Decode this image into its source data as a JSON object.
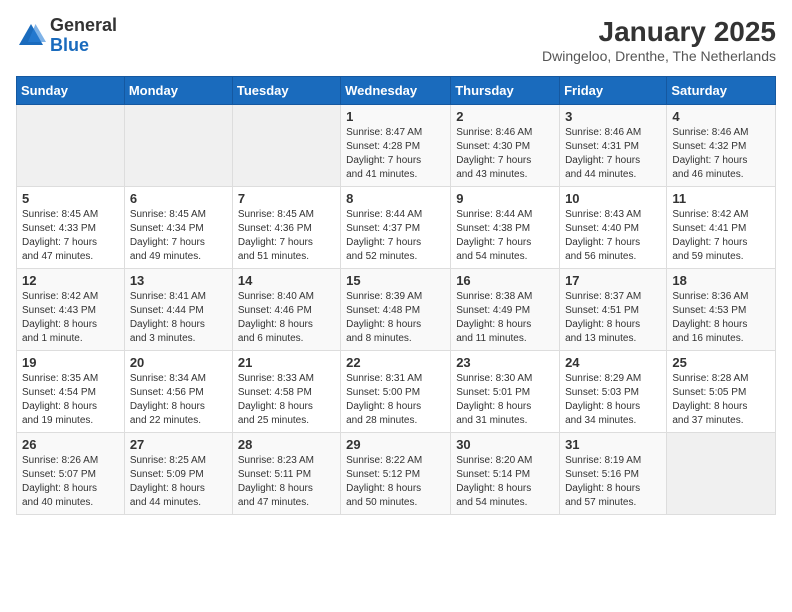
{
  "header": {
    "logo_general": "General",
    "logo_blue": "Blue",
    "title": "January 2025",
    "subtitle": "Dwingeloo, Drenthe, The Netherlands"
  },
  "weekdays": [
    "Sunday",
    "Monday",
    "Tuesday",
    "Wednesday",
    "Thursday",
    "Friday",
    "Saturday"
  ],
  "weeks": [
    [
      {
        "day": "",
        "info": ""
      },
      {
        "day": "",
        "info": ""
      },
      {
        "day": "",
        "info": ""
      },
      {
        "day": "1",
        "info": "Sunrise: 8:47 AM\nSunset: 4:28 PM\nDaylight: 7 hours\nand 41 minutes."
      },
      {
        "day": "2",
        "info": "Sunrise: 8:46 AM\nSunset: 4:30 PM\nDaylight: 7 hours\nand 43 minutes."
      },
      {
        "day": "3",
        "info": "Sunrise: 8:46 AM\nSunset: 4:31 PM\nDaylight: 7 hours\nand 44 minutes."
      },
      {
        "day": "4",
        "info": "Sunrise: 8:46 AM\nSunset: 4:32 PM\nDaylight: 7 hours\nand 46 minutes."
      }
    ],
    [
      {
        "day": "5",
        "info": "Sunrise: 8:45 AM\nSunset: 4:33 PM\nDaylight: 7 hours\nand 47 minutes."
      },
      {
        "day": "6",
        "info": "Sunrise: 8:45 AM\nSunset: 4:34 PM\nDaylight: 7 hours\nand 49 minutes."
      },
      {
        "day": "7",
        "info": "Sunrise: 8:45 AM\nSunset: 4:36 PM\nDaylight: 7 hours\nand 51 minutes."
      },
      {
        "day": "8",
        "info": "Sunrise: 8:44 AM\nSunset: 4:37 PM\nDaylight: 7 hours\nand 52 minutes."
      },
      {
        "day": "9",
        "info": "Sunrise: 8:44 AM\nSunset: 4:38 PM\nDaylight: 7 hours\nand 54 minutes."
      },
      {
        "day": "10",
        "info": "Sunrise: 8:43 AM\nSunset: 4:40 PM\nDaylight: 7 hours\nand 56 minutes."
      },
      {
        "day": "11",
        "info": "Sunrise: 8:42 AM\nSunset: 4:41 PM\nDaylight: 7 hours\nand 59 minutes."
      }
    ],
    [
      {
        "day": "12",
        "info": "Sunrise: 8:42 AM\nSunset: 4:43 PM\nDaylight: 8 hours\nand 1 minute."
      },
      {
        "day": "13",
        "info": "Sunrise: 8:41 AM\nSunset: 4:44 PM\nDaylight: 8 hours\nand 3 minutes."
      },
      {
        "day": "14",
        "info": "Sunrise: 8:40 AM\nSunset: 4:46 PM\nDaylight: 8 hours\nand 6 minutes."
      },
      {
        "day": "15",
        "info": "Sunrise: 8:39 AM\nSunset: 4:48 PM\nDaylight: 8 hours\nand 8 minutes."
      },
      {
        "day": "16",
        "info": "Sunrise: 8:38 AM\nSunset: 4:49 PM\nDaylight: 8 hours\nand 11 minutes."
      },
      {
        "day": "17",
        "info": "Sunrise: 8:37 AM\nSunset: 4:51 PM\nDaylight: 8 hours\nand 13 minutes."
      },
      {
        "day": "18",
        "info": "Sunrise: 8:36 AM\nSunset: 4:53 PM\nDaylight: 8 hours\nand 16 minutes."
      }
    ],
    [
      {
        "day": "19",
        "info": "Sunrise: 8:35 AM\nSunset: 4:54 PM\nDaylight: 8 hours\nand 19 minutes."
      },
      {
        "day": "20",
        "info": "Sunrise: 8:34 AM\nSunset: 4:56 PM\nDaylight: 8 hours\nand 22 minutes."
      },
      {
        "day": "21",
        "info": "Sunrise: 8:33 AM\nSunset: 4:58 PM\nDaylight: 8 hours\nand 25 minutes."
      },
      {
        "day": "22",
        "info": "Sunrise: 8:31 AM\nSunset: 5:00 PM\nDaylight: 8 hours\nand 28 minutes."
      },
      {
        "day": "23",
        "info": "Sunrise: 8:30 AM\nSunset: 5:01 PM\nDaylight: 8 hours\nand 31 minutes."
      },
      {
        "day": "24",
        "info": "Sunrise: 8:29 AM\nSunset: 5:03 PM\nDaylight: 8 hours\nand 34 minutes."
      },
      {
        "day": "25",
        "info": "Sunrise: 8:28 AM\nSunset: 5:05 PM\nDaylight: 8 hours\nand 37 minutes."
      }
    ],
    [
      {
        "day": "26",
        "info": "Sunrise: 8:26 AM\nSunset: 5:07 PM\nDaylight: 8 hours\nand 40 minutes."
      },
      {
        "day": "27",
        "info": "Sunrise: 8:25 AM\nSunset: 5:09 PM\nDaylight: 8 hours\nand 44 minutes."
      },
      {
        "day": "28",
        "info": "Sunrise: 8:23 AM\nSunset: 5:11 PM\nDaylight: 8 hours\nand 47 minutes."
      },
      {
        "day": "29",
        "info": "Sunrise: 8:22 AM\nSunset: 5:12 PM\nDaylight: 8 hours\nand 50 minutes."
      },
      {
        "day": "30",
        "info": "Sunrise: 8:20 AM\nSunset: 5:14 PM\nDaylight: 8 hours\nand 54 minutes."
      },
      {
        "day": "31",
        "info": "Sunrise: 8:19 AM\nSunset: 5:16 PM\nDaylight: 8 hours\nand 57 minutes."
      },
      {
        "day": "",
        "info": ""
      }
    ]
  ]
}
